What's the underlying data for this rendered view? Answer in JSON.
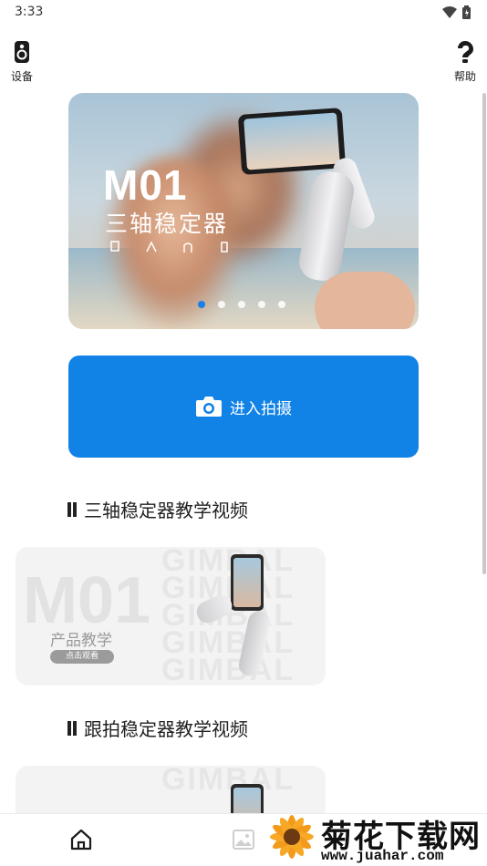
{
  "status_bar": {
    "time": "3:33"
  },
  "header": {
    "left": {
      "label": "设备",
      "icon": "device-icon"
    },
    "right": {
      "label": "帮助",
      "icon": "help-icon"
    }
  },
  "banner": {
    "title": "M01",
    "subtitle": "三轴稳定器",
    "slide_count": 5,
    "active_slide": 1
  },
  "capture_button": {
    "label": "进入拍摄",
    "icon": "camera-icon",
    "color": "#1182e6"
  },
  "sections": [
    {
      "title": "三轴稳定器教学视频",
      "card": {
        "big_text": "M01",
        "watermark": "GIMBAL\nGIMBAL\nGIMBAL\nGIMBAL\nGIMBAL",
        "caption": "产品教学",
        "button": "点击观看"
      }
    },
    {
      "title": "跟拍稳定器教学视频",
      "card": {
        "watermark": "GIMBAL"
      }
    }
  ],
  "bottom_nav": [
    {
      "name": "home",
      "icon": "home-icon"
    },
    {
      "name": "gallery",
      "icon": "image-icon"
    }
  ],
  "site_watermark": {
    "name": "菊花下载网",
    "url": "www.juahar.com"
  }
}
